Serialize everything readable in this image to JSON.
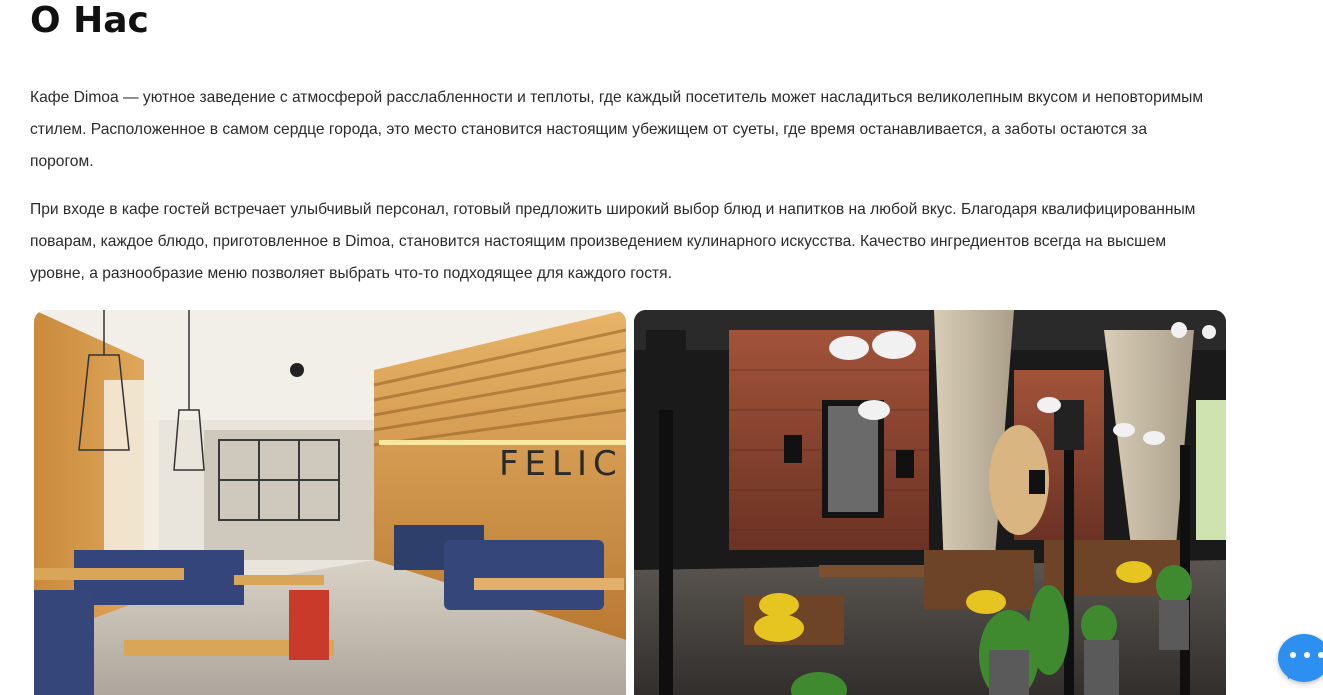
{
  "about": {
    "title": "О Нас",
    "paragraphs": [
      "Кафе Dimoa — уютное заведение с атмосферой расслабленности и теплоты, где каждый посетитель может насладиться великолепным вкусом и неповторимым стилем. Расположенное в самом сердце города, это место становится настоящим убежищем от суеты, где время останавливается, а заботы остаются за порогом.",
      "При входе в кафе гостей встречает улыбчивый персонал, готовый предложить широкий выбор блюд и напитков на любой вкус. Благодаря квалифицированным поварам, каждое блюдо, приготовленное в Dimoa, становится настоящим произведением кулинарного искусства. Качество ингредиентов всегда на высшем уровне, а разнообразие меню позволяет выбрать что-то подходящее для каждого гостя."
    ]
  },
  "gallery": {
    "photos": [
      {
        "name": "cafe-interior-wood-photo",
        "wall_sign": "FELIC"
      },
      {
        "name": "cafe-interior-brick-photo"
      }
    ]
  },
  "chat_widget": {
    "icon": "chat-bubble-icon",
    "color": "#2d8ff0"
  }
}
